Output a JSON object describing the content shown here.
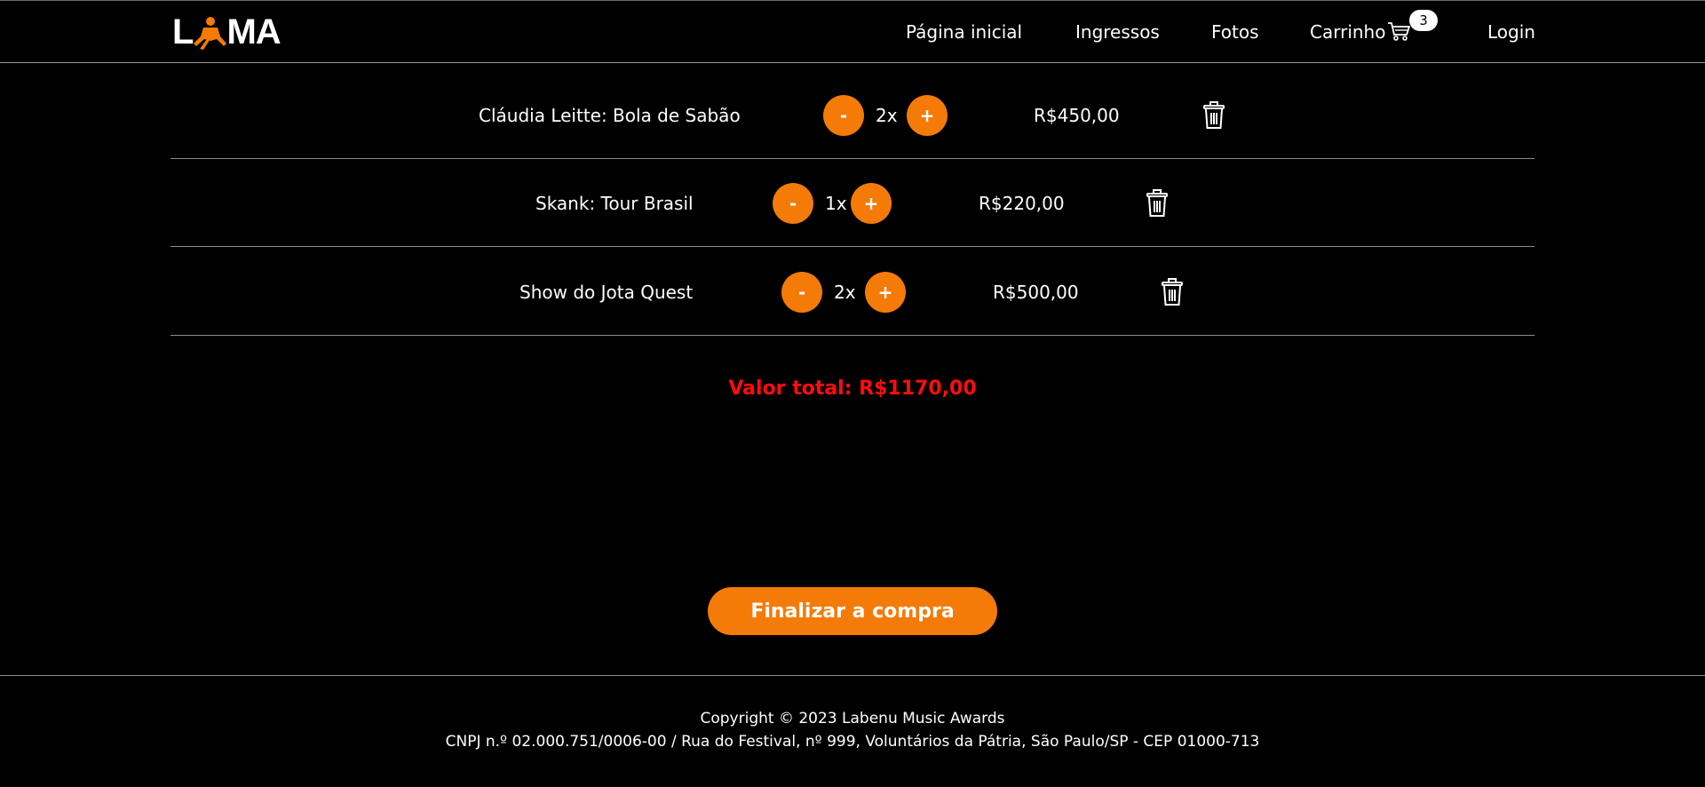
{
  "brand": {
    "logo_text_left": "L",
    "logo_text_right": "MA",
    "accent_color": "#f47b07"
  },
  "nav": {
    "home": "Página inicial",
    "tickets": "Ingressos",
    "photos": "Fotos",
    "cart": "Carrinho",
    "cart_count": "3",
    "login": "Login"
  },
  "cart": {
    "items": [
      {
        "name": "Cláudia Leitte: Bola de Sabão",
        "qty": "2x",
        "price": "R$450,00",
        "minus": "-",
        "plus": "+"
      },
      {
        "name": "Skank: Tour Brasil",
        "qty": "1x",
        "price": "R$220,00",
        "minus": "-",
        "plus": "+"
      },
      {
        "name": "Show do Jota Quest",
        "qty": "2x",
        "price": "R$500,00",
        "minus": "-",
        "plus": "+"
      }
    ],
    "total_label": "Valor total: R$1170,00",
    "total_color": "#ff0d0d",
    "checkout_label": "Finalizar a compra"
  },
  "footer": {
    "copyright": "Copyright © 2023 Labenu Music Awards",
    "address": "CNPJ n.º 02.000.751/0006-00 / Rua do Festival, nº 999, Voluntários da Pátria, São Paulo/SP - CEP 01000-713"
  }
}
